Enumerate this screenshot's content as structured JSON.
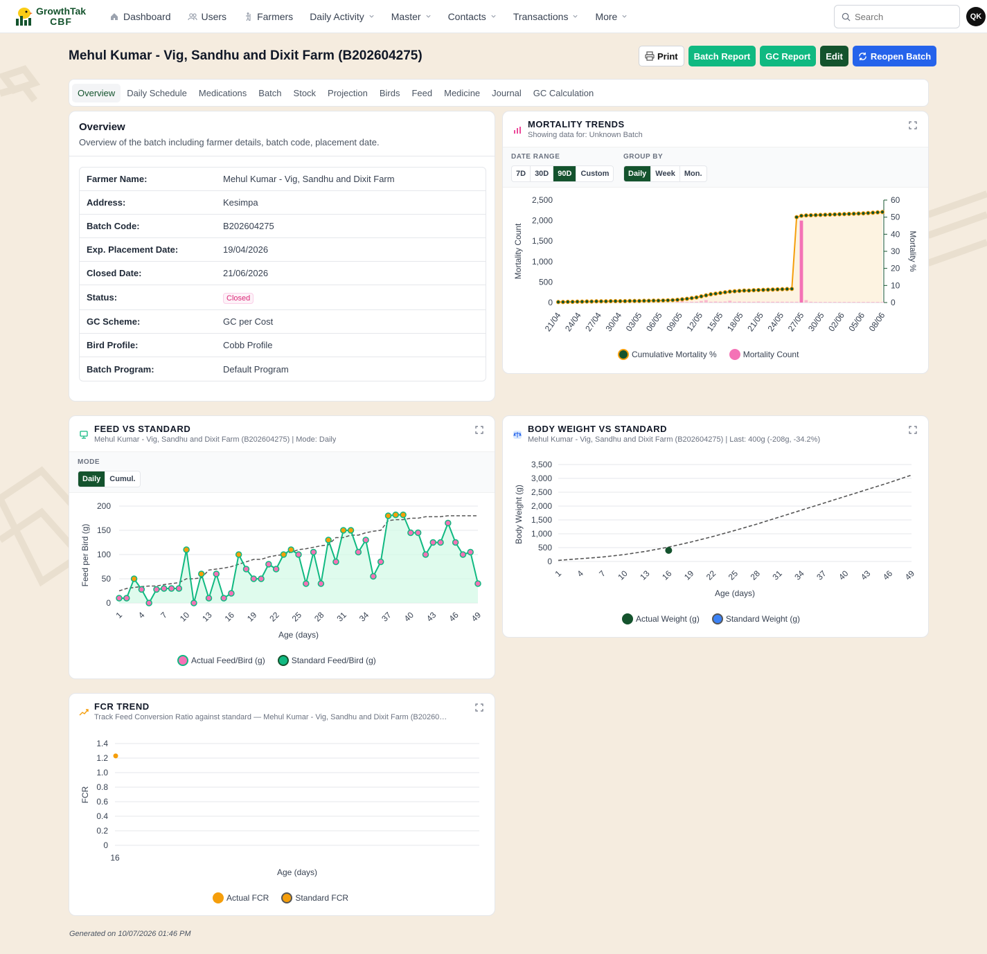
{
  "app": {
    "name_line1": "GrowthTak",
    "name_line2": "CBF"
  },
  "nav": [
    {
      "label": "Dashboard",
      "icon": "home-icon",
      "dropdown": false
    },
    {
      "label": "Users",
      "icon": "users-icon",
      "dropdown": false
    },
    {
      "label": "Farmers",
      "icon": "farmer-icon",
      "dropdown": false
    },
    {
      "label": "Daily Activity",
      "icon": "",
      "dropdown": true
    },
    {
      "label": "Master",
      "icon": "",
      "dropdown": true
    },
    {
      "label": "Contacts",
      "icon": "",
      "dropdown": true
    },
    {
      "label": "Transactions",
      "icon": "",
      "dropdown": true
    },
    {
      "label": "More",
      "icon": "",
      "dropdown": true
    }
  ],
  "search": {
    "placeholder": "Search"
  },
  "user": {
    "initials": "QK"
  },
  "page": {
    "title": "Mehul Kumar - Vig, Sandhu and Dixit Farm (B202604275)"
  },
  "actions": {
    "print": "Print",
    "batch_report": "Batch Report",
    "gc_report": "GC Report",
    "edit": "Edit",
    "reopen": "Reopen Batch"
  },
  "tabs": [
    "Overview",
    "Daily Schedule",
    "Medications",
    "Batch",
    "Stock",
    "Projection",
    "Birds",
    "Feed",
    "Medicine",
    "Journal",
    "GC Calculation"
  ],
  "overview": {
    "title": "Overview",
    "description": "Overview of the batch including farmer details, batch code, placement date.",
    "rows": [
      {
        "k": "Farmer Name:",
        "v": "Mehul Kumar - Vig, Sandhu and Dixit Farm"
      },
      {
        "k": "Address:",
        "v": "Kesimpa"
      },
      {
        "k": "Batch Code:",
        "v": "B202604275"
      },
      {
        "k": "Exp. Placement Date:",
        "v": "19/04/2026"
      },
      {
        "k": "Closed Date:",
        "v": "21/06/2026"
      },
      {
        "k": "Status:",
        "v": "Closed"
      },
      {
        "k": "GC Scheme:",
        "v": "GC per Cost"
      },
      {
        "k": "Bird Profile:",
        "v": "Cobb Profile"
      },
      {
        "k": "Batch Program:",
        "v": "Default Program"
      }
    ]
  },
  "mortality": {
    "title": "MORTALITY TRENDS",
    "subtitle": "Showing data for: Unknown Batch",
    "date_range_label": "DATE RANGE",
    "date_range_options": [
      "7D",
      "30D",
      "90D",
      "Custom"
    ],
    "date_range_selected": "90D",
    "group_by_label": "GROUP BY",
    "group_by_options": [
      "Daily",
      "Week",
      "Mon."
    ],
    "group_by_selected": "Daily",
    "legend": [
      "Cumulative Mortality %",
      "Mortality Count"
    ],
    "colors": {
      "line": "#f59e0b",
      "point": "#14532d",
      "bar": "#f472b6"
    }
  },
  "feed": {
    "title": "FEED VS STANDARD",
    "subtitle": "Mehul Kumar - Vig, Sandhu and Dixit Farm (B202604275) | Mode: Daily",
    "mode_label": "MODE",
    "mode_options": [
      "Daily",
      "Cumul."
    ],
    "mode_selected": "Daily",
    "legend": [
      "Actual Feed/Bird (g)",
      "Standard Feed/Bird (g)"
    ],
    "colors": {
      "line": "#10b981",
      "point": "#f472b6",
      "fill": "#d1fae5",
      "standard": "#555555"
    }
  },
  "bodyweight": {
    "title": "BODY WEIGHT VS STANDARD",
    "subtitle": "Mehul Kumar - Vig, Sandhu and Dixit Farm (B202604275) | Last: 400g (-208g, -34.2%)",
    "legend": [
      "Actual Weight (g)",
      "Standard Weight (g)"
    ],
    "colors": {
      "actual": "#14532d",
      "standard": "#3b82f6"
    }
  },
  "fcr": {
    "title": "FCR TREND",
    "subtitle": "Track Feed Conversion Ratio against standard — Mehul Kumar - Vig, Sandhu and Dixit Farm (B20260…",
    "legend": [
      "Actual FCR",
      "Standard FCR"
    ],
    "colors": {
      "actual": "#f59e0b"
    }
  },
  "footer": {
    "generated": "Generated on 10/07/2026 01:46 PM"
  },
  "chart_data": [
    {
      "id": "mortality",
      "type": "bar",
      "title": "",
      "xlabel": "",
      "ylabel": "Mortality Count",
      "y2label": "Mortality %",
      "x_ticks": [
        "21/04",
        "24/04",
        "27/04",
        "30/04",
        "03/05",
        "06/05",
        "09/05",
        "12/05",
        "15/05",
        "18/05",
        "21/05",
        "24/05",
        "27/05",
        "30/05",
        "02/06",
        "05/06",
        "08/06"
      ],
      "ylim": [
        0,
        2500
      ],
      "y_ticks": [
        0,
        500,
        1000,
        1500,
        2000,
        2500
      ],
      "y2lim": [
        0,
        60
      ],
      "y2_ticks": [
        0,
        10,
        20,
        30,
        40,
        50,
        60
      ],
      "series": [
        {
          "name": "Mortality Count",
          "kind": "bar",
          "axis": "y",
          "values": [
            0,
            0,
            0,
            0,
            0,
            0,
            0,
            0,
            0,
            0,
            0,
            0,
            0,
            0,
            0,
            0,
            0,
            0,
            0,
            0,
            0,
            0,
            0,
            0,
            0,
            30,
            35,
            15,
            20,
            20,
            40,
            60,
            20,
            25,
            20,
            25,
            45,
            20,
            25,
            20,
            20,
            20,
            25,
            20,
            20,
            20,
            20,
            20,
            20,
            20,
            20,
            2000,
            60,
            20,
            15,
            15,
            15,
            15,
            15,
            15,
            15,
            15,
            15,
            15,
            15,
            15,
            15,
            15,
            15
          ]
        },
        {
          "name": "Cumulative Mortality %",
          "kind": "line",
          "axis": "y2",
          "values": [
            0.3,
            0.3,
            0.4,
            0.4,
            0.5,
            0.5,
            0.6,
            0.6,
            0.7,
            0.7,
            0.7,
            0.8,
            0.8,
            0.8,
            0.8,
            0.9,
            0.9,
            0.9,
            1.0,
            1.0,
            1.1,
            1.1,
            1.2,
            1.3,
            1.4,
            1.6,
            1.9,
            2.2,
            2.6,
            3.0,
            3.6,
            4.2,
            4.8,
            5.2,
            5.6,
            6.0,
            6.4,
            6.6,
            6.8,
            7.0,
            7.0,
            7.2,
            7.3,
            7.4,
            7.5,
            7.6,
            7.7,
            7.8,
            7.9,
            8.0,
            50.0,
            50.8,
            51.0,
            51.1,
            51.2,
            51.3,
            51.4,
            51.5,
            51.6,
            51.7,
            51.8,
            51.9,
            52.0,
            52.1,
            52.2,
            52.4,
            52.6,
            52.8,
            53.0
          ]
        }
      ]
    },
    {
      "id": "feed",
      "type": "line",
      "xlabel": "Age (days)",
      "ylabel": "Feed per Bird (g)",
      "x": [
        1,
        2,
        3,
        4,
        5,
        6,
        7,
        8,
        9,
        10,
        11,
        12,
        13,
        14,
        15,
        16,
        17,
        18,
        19,
        20,
        21,
        22,
        23,
        24,
        25,
        26,
        27,
        28,
        29,
        30,
        31,
        32,
        33,
        34,
        35,
        36,
        37,
        38,
        39,
        40,
        41,
        42,
        43,
        44,
        45,
        46,
        47,
        48,
        49
      ],
      "x_ticks": [
        1,
        4,
        7,
        10,
        13,
        16,
        19,
        22,
        25,
        28,
        31,
        34,
        37,
        40,
        43,
        46,
        49
      ],
      "ylim": [
        0,
        200
      ],
      "y_ticks": [
        0,
        50,
        100,
        150,
        200
      ],
      "series": [
        {
          "name": "Actual Feed/Bird (g)",
          "values": [
            10,
            10,
            50,
            28,
            0,
            28,
            30,
            30,
            30,
            110,
            0,
            60,
            10,
            60,
            10,
            20,
            100,
            70,
            50,
            50,
            80,
            70,
            100,
            110,
            100,
            40,
            105,
            40,
            130,
            85,
            150,
            150,
            105,
            130,
            55,
            85,
            180,
            182,
            182,
            145,
            145,
            100,
            125,
            125,
            165,
            125,
            100,
            105,
            40
          ]
        },
        {
          "name": "Standard Feed/Bird (g)",
          "style": "dashed",
          "values": [
            25,
            30,
            32,
            34,
            35,
            35,
            38,
            40,
            42,
            50,
            50,
            52,
            68,
            70,
            72,
            75,
            80,
            85,
            90,
            90,
            95,
            98,
            100,
            105,
            110,
            112,
            115,
            118,
            120,
            135,
            135,
            140,
            140,
            145,
            148,
            150,
            170,
            172,
            172,
            175,
            175,
            178,
            178,
            178,
            180,
            180,
            180,
            180,
            180
          ]
        }
      ]
    },
    {
      "id": "bodyweight",
      "type": "line",
      "xlabel": "Age (days)",
      "ylabel": "Body Weight (g)",
      "x_ticks": [
        1,
        4,
        7,
        10,
        13,
        16,
        19,
        22,
        25,
        28,
        31,
        34,
        37,
        40,
        43,
        46,
        49
      ],
      "ylim": [
        0,
        3500
      ],
      "y_ticks": [
        0,
        500,
        1000,
        1500,
        2000,
        2500,
        3000,
        3500
      ],
      "series": [
        {
          "name": "Actual Weight (g)",
          "points": [
            [
              16,
              400
            ]
          ]
        },
        {
          "name": "Standard Weight (g)",
          "style": "dashed",
          "points": [
            [
              1,
              40
            ],
            [
              4,
              100
            ],
            [
              7,
              160
            ],
            [
              10,
              250
            ],
            [
              13,
              370
            ],
            [
              16,
              520
            ],
            [
              19,
              700
            ],
            [
              22,
              900
            ],
            [
              25,
              1120
            ],
            [
              28,
              1350
            ],
            [
              31,
              1600
            ],
            [
              34,
              1850
            ],
            [
              37,
              2100
            ],
            [
              40,
              2350
            ],
            [
              43,
              2600
            ],
            [
              46,
              2850
            ],
            [
              49,
              3120
            ]
          ]
        }
      ]
    },
    {
      "id": "fcr",
      "type": "scatter",
      "xlabel": "Age (days)",
      "ylabel": "FCR",
      "x_ticks": [
        16
      ],
      "ylim": [
        0,
        1.4
      ],
      "y_ticks": [
        0,
        0.2,
        0.4,
        0.6,
        0.8,
        1.0,
        1.2,
        1.4
      ],
      "series": [
        {
          "name": "Actual FCR",
          "points": [
            [
              16,
              1.23
            ]
          ]
        },
        {
          "name": "Standard FCR",
          "points": []
        }
      ]
    }
  ]
}
